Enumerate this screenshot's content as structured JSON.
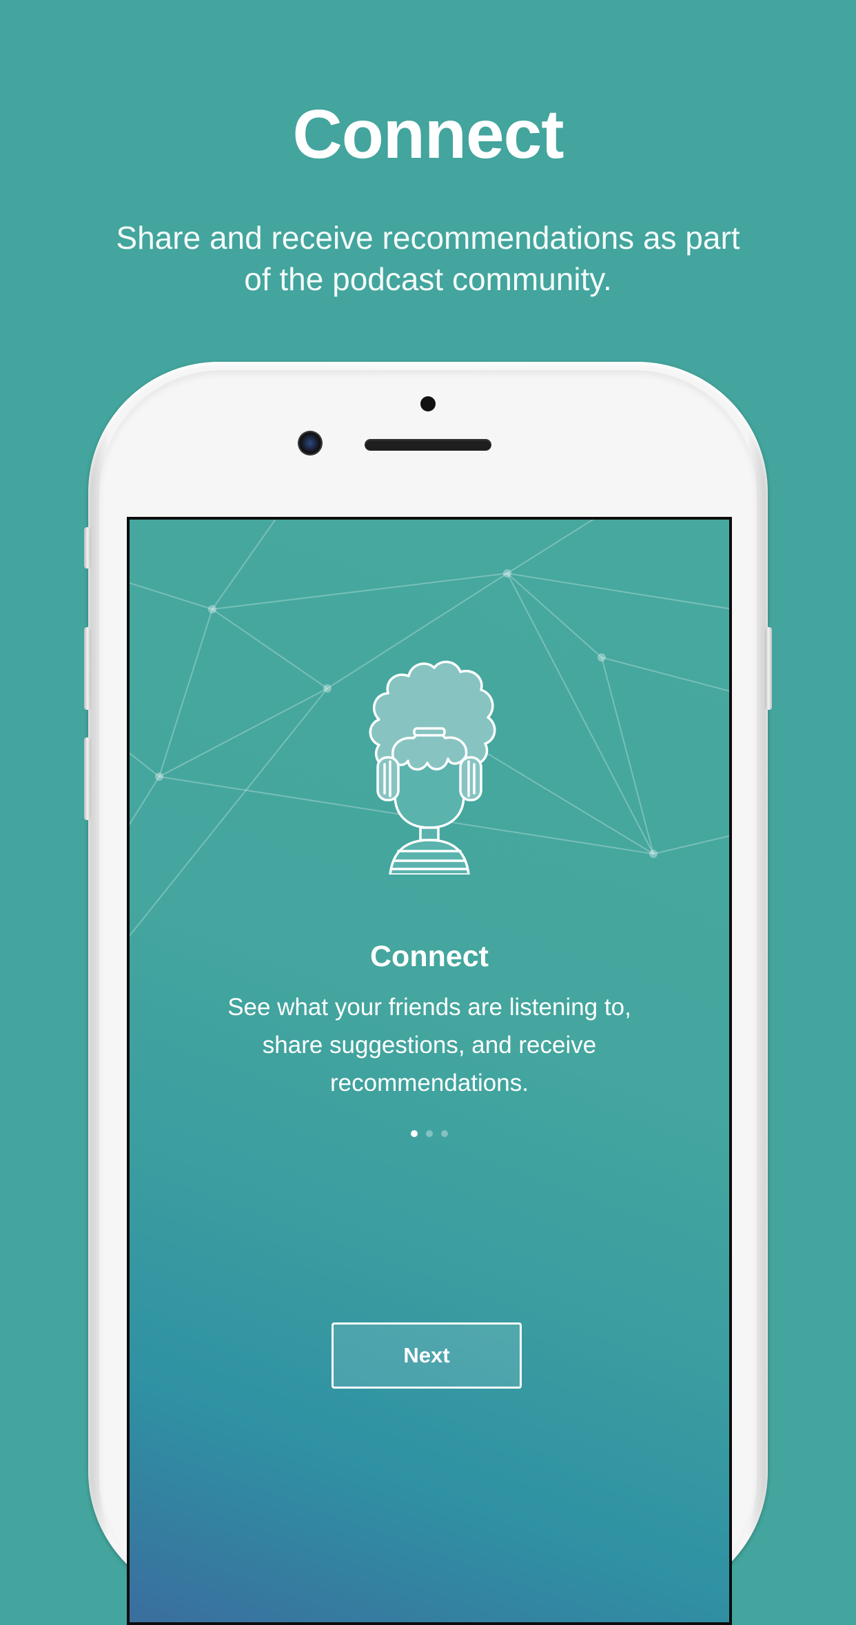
{
  "promo": {
    "title": "Connect",
    "subtitle": "Share and receive recommendations as part of the podcast community."
  },
  "screen": {
    "illustration_icon": "listener-with-headphones-icon",
    "title": "Connect",
    "body": "See what your friends are listening to, share suggestions, and receive recommendations.",
    "pagination": {
      "total": 3,
      "current": 1
    },
    "next_button_label": "Next"
  },
  "colors": {
    "background": "#43a59d",
    "screen_gradient_top": "#47a89f",
    "screen_gradient_bottom": "#3a6e9e",
    "text": "#ffffff",
    "phone_body": "#f7f7f7"
  }
}
